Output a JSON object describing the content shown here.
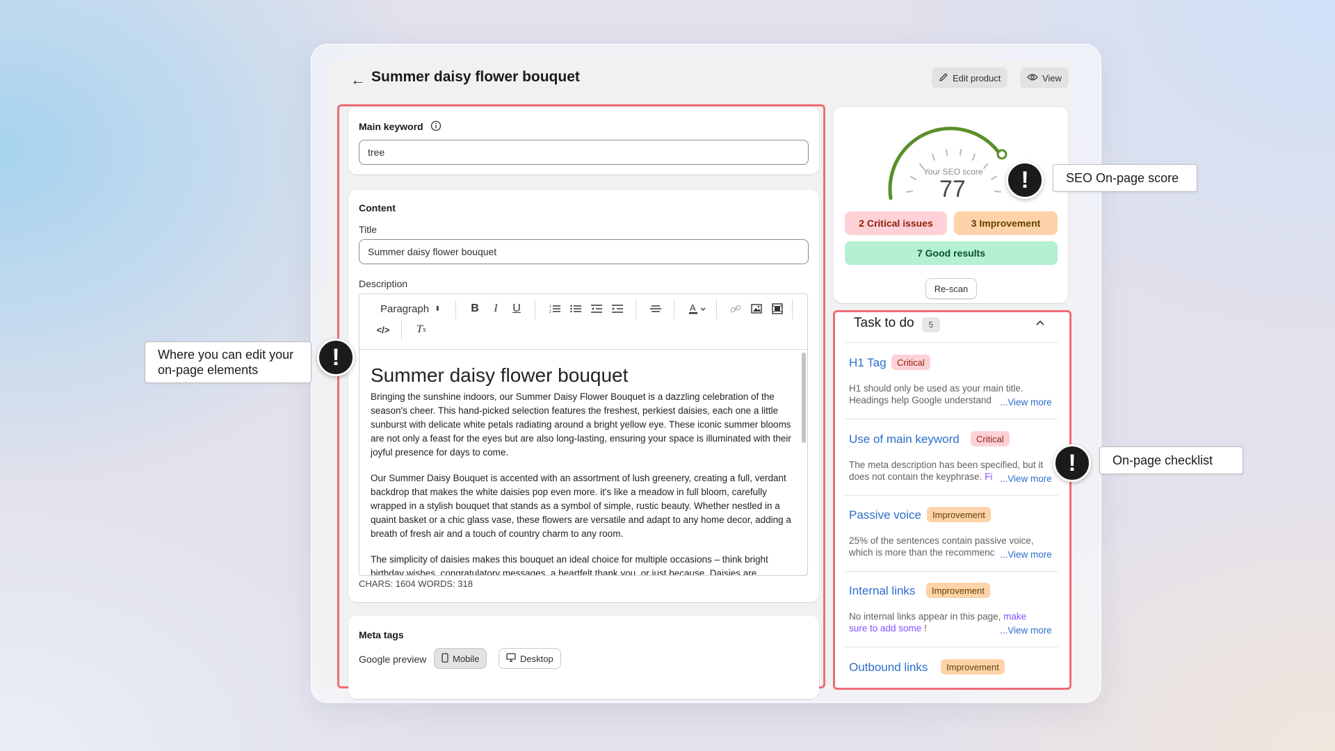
{
  "header": {
    "back_icon": "arrow-left-icon",
    "title": "Summer daisy flower bouquet",
    "edit_product_label": "Edit product",
    "view_label": "View"
  },
  "main_keyword": {
    "label": "Main keyword",
    "value": "tree"
  },
  "content": {
    "heading": "Content",
    "title_label": "Title",
    "title_value": "Summer daisy flower bouquet",
    "description_label": "Description",
    "toolbar": {
      "format_select": "Paragraph"
    },
    "editor_heading": "Summer daisy flower bouquet",
    "paragraphs": [
      "Bringing the sunshine indoors, our Summer Daisy Flower Bouquet is a dazzling celebration of the season's cheer. This hand-picked selection features the freshest, perkiest daisies, each one a little sunburst with delicate white petals radiating around a bright yellow eye. These iconic summer blooms are not only a feast for the eyes but are also long-lasting, ensuring your space is illuminated with their joyful presence for days to come.",
      "Our Summer Daisy Bouquet is accented with an assortment of lush greenery, creating a full, verdant backdrop that makes the white daisies pop even more. it's like a meadow in full bloom, carefully wrapped in a stylish bouquet that stands as a symbol of simple, rustic beauty. Whether nestled in a quaint basket or a chic glass vase, these flowers are versatile and adapt to any home decor, adding a breath of fresh air and a touch of country charm to any room.",
      "The simplicity of daisies makes this bouquet an ideal choice for multiple occasions – think bright birthday wishes, congratulatory messages, a heartfelt thank you, or just because. Daisies are"
    ],
    "counts": "CHARS: 1604 WORDS: 318"
  },
  "meta_tags": {
    "heading": "Meta tags",
    "google_preview_label": "Google preview",
    "mobile_label": "Mobile",
    "desktop_label": "Desktop"
  },
  "seo_score": {
    "label": "Your SEO score",
    "value": 77,
    "value_text": "77",
    "critical_label": "2 Critical issues",
    "improvement_label": "3 Improvement",
    "good_label": "7 Good results",
    "rescan_label": "Re-scan"
  },
  "tasks": {
    "title": "Task to do",
    "count": "5",
    "view_more": "...View more",
    "items": [
      {
        "name": "H1 Tag",
        "badge": "Critical",
        "desc_line1": "H1 should only be used as your main title.",
        "desc_line2": "Headings help Google understand"
      },
      {
        "name": "Use of main keyword",
        "badge": "Critical",
        "desc_line1": "The meta description has been specified, but it",
        "desc_line2": "does not contain the keyphrase.",
        "desc_link": "Fi"
      },
      {
        "name": "Passive voice",
        "badge": "Improvement",
        "desc_line1": "25% of the sentences contain passive voice,",
        "desc_line2": "which is more than the recommenc"
      },
      {
        "name": "Internal links",
        "badge": "Improvement",
        "desc_line1": "No internal links appear in this page,",
        "desc_link1": "make",
        "desc_link2": "sure to add some",
        "desc_tail": "!"
      },
      {
        "name": "Outbound links",
        "badge": "Improvement"
      }
    ]
  },
  "callouts": {
    "edit": "Where you can edit your on-page elements",
    "score": "SEO On-page score",
    "checklist": "On-page checklist",
    "mark_glyph": "!"
  },
  "colors": {
    "highlight": "#f06b73",
    "gauge": "#5a8f29",
    "link": "#2c6ecb",
    "critical_bg": "#fed1d7",
    "improvement_bg": "#fed3a9",
    "good_bg": "#b4f0d2"
  }
}
